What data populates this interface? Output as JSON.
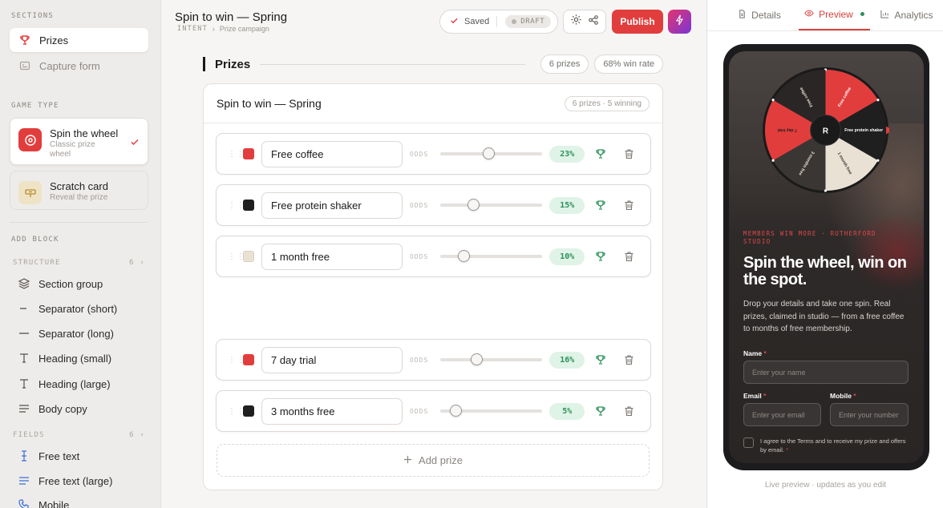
{
  "sidebar": {
    "sections_heading": "SECTIONS",
    "sections": [
      {
        "label": "Prizes",
        "icon": "trophy-icon"
      },
      {
        "label": "Capture form",
        "icon": "form-icon"
      }
    ],
    "game_type_heading": "GAME TYPE",
    "game_types": [
      {
        "title": "Spin the wheel",
        "subtitle": "Classic prize wheel",
        "icon": "target-icon",
        "color": "#e23d3d"
      },
      {
        "title": "Scratch card",
        "subtitle": "Reveal the prize",
        "icon": "ticket-icon",
        "color": "#c9a04a"
      }
    ],
    "add_block_heading": "ADD BLOCK",
    "structure_heading": "STRUCTURE",
    "structure_count": "6",
    "structure_items": [
      {
        "label": "Section group",
        "icon": "layers-icon"
      },
      {
        "label": "Separator (short)",
        "icon": "minus-icon"
      },
      {
        "label": "Separator (long)",
        "icon": "minus-icon"
      },
      {
        "label": "Heading (small)",
        "icon": "type-icon"
      },
      {
        "label": "Heading (large)",
        "icon": "type-icon"
      },
      {
        "label": "Body copy",
        "icon": "align-left-icon"
      }
    ],
    "fields_heading": "FIELDS",
    "fields_count": "6",
    "field_items": [
      {
        "label": "Free text",
        "icon": "text-cursor-icon"
      },
      {
        "label": "Free text (large)",
        "icon": "align-left-icon"
      },
      {
        "label": "Mobile",
        "icon": "phone-icon"
      }
    ]
  },
  "header": {
    "title": "Spin to win — Spring",
    "crumb_intent": "INTENT",
    "crumb_page": "Prize campaign",
    "saved_label": "Saved",
    "draft_label": "DRAFT",
    "publish_label": "Publish"
  },
  "prizes_section": {
    "label": "Prizes",
    "count_pill": "6 prizes",
    "rate_pill": "68% win rate",
    "card_title": "Spin to win — Spring",
    "card_badge": "6 prizes · 5 winning",
    "odds_label": "ODDS",
    "add_prize_label": "Add prize",
    "rows": [
      {
        "name": "Free coffee",
        "color": "#e23d3d",
        "pct": "23%",
        "level": 0.47
      },
      {
        "name": "Free protein shaker",
        "color": "#1f1f1f",
        "pct": "15%",
        "level": 0.32
      },
      {
        "name": "1 month free",
        "color": "#e9e1d4",
        "pct": "10%",
        "level": 0.23
      },
      {
        "name": "7 day trial",
        "color": "#e23d3d",
        "pct": "16%",
        "level": 0.35
      },
      {
        "name": "3 months free",
        "color": "#1f1f1f",
        "pct": "5%",
        "level": 0.15
      }
    ]
  },
  "preview": {
    "tabs": [
      "Details",
      "Preview",
      "Analytics"
    ],
    "active_tab": "Preview",
    "wheel_center": "R",
    "wheel_segments": [
      "Free coffee",
      "Free protein shaker",
      "1 month free",
      "3 months free",
      "7 day trial",
      "Free coffee"
    ],
    "eyebrow": "MEMBERS WIN MORE · RUTHERFORD STUDIO",
    "headline": "Spin the wheel, win on the spot.",
    "body": "Drop your details and take one spin. Real prizes, claimed in studio — from a free coffee to months of free membership.",
    "name_label": "Name",
    "name_placeholder": "Enter your name",
    "email_label": "Email",
    "email_placeholder": "Enter your email",
    "mobile_label": "Mobile",
    "mobile_placeholder": "Enter your number",
    "consent": "I agree to the Terms and to receive my prize and offers by email.",
    "required_mark": "*",
    "footer": "Live preview · updates as you edit"
  }
}
